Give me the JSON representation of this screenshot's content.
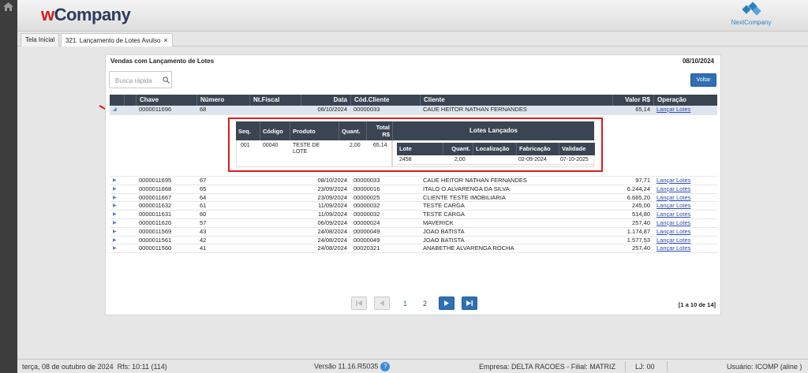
{
  "header": {
    "logo_w": "w",
    "logo_rest": "Company",
    "nc_logo": "NextCompany"
  },
  "tabs": [
    {
      "label": "Tela Inicial"
    },
    {
      "label": "321. Lançamento de Lotes Avulso",
      "close": "×"
    }
  ],
  "panel": {
    "title": "Vendas com Lançamento de Lotes",
    "date": "08/10/2024",
    "search_placeholder": "Busca rápida",
    "voltar": "Voltar"
  },
  "grid": {
    "headers": [
      "Chave",
      "Número",
      "Nt.Fiscal",
      "Data",
      "Cód.Cliente",
      "Cliente",
      "Valor R$",
      "Operação"
    ],
    "selected": {
      "chave": "0000011696",
      "numero": "68",
      "nf": "",
      "data": "08/10/2024",
      "cod": "00000033",
      "cliente": "CAUE HEITOR NATHAN FERNANDES",
      "valor": "65,14",
      "op": "Lançar Lotes"
    },
    "rows": [
      {
        "chave": "0000011695",
        "numero": "67",
        "nf": "",
        "data": "08/10/2024",
        "cod": "00000033",
        "cliente": "CAUE HEITOR NATHAN FERNANDES",
        "valor": "97,71",
        "op": "Lançar Lotes"
      },
      {
        "chave": "0000011668",
        "numero": "65",
        "nf": "",
        "data": "23/09/2024",
        "cod": "00000016",
        "cliente": "ITALO O.ALVARENGA DA SILVA",
        "valor": "6.244,24",
        "op": "Lançar Lotes"
      },
      {
        "chave": "0000011667",
        "numero": "64",
        "nf": "",
        "data": "23/09/2024",
        "cod": "00000025",
        "cliente": "CLIENTE TESTE IMOBILIARIA",
        "valor": "6.665,20",
        "op": "Lançar Lotes"
      },
      {
        "chave": "0000011632",
        "numero": "61",
        "nf": "",
        "data": "11/09/2024",
        "cod": "00000032",
        "cliente": "TESTE CARGA",
        "valor": "245,00",
        "op": "Lançar Lotes"
      },
      {
        "chave": "0000011631",
        "numero": "60",
        "nf": "",
        "data": "11/09/2024",
        "cod": "00000032",
        "cliente": "TESTE CARGA",
        "valor": "514,80",
        "op": "Lançar Lotes"
      },
      {
        "chave": "0000011620",
        "numero": "57",
        "nf": "",
        "data": "06/09/2024",
        "cod": "00000024",
        "cliente": "MAVERICK",
        "valor": "257,40",
        "op": "Lançar Lotes"
      },
      {
        "chave": "0000011569",
        "numero": "43",
        "nf": "",
        "data": "24/08/2024",
        "cod": "00000049",
        "cliente": "JOAO BATISTA",
        "valor": "1.174,87",
        "op": "Lançar Lotes"
      },
      {
        "chave": "0000011561",
        "numero": "42",
        "nf": "",
        "data": "24/08/2024",
        "cod": "00000049",
        "cliente": "JOAO BATISTA",
        "valor": "1.577,53",
        "op": "Lançar Lotes"
      },
      {
        "chave": "0000011560",
        "numero": "41",
        "nf": "",
        "data": "24/08/2024",
        "cod": "00020321",
        "cliente": "ANABETHE ALVARENGA ROCHA",
        "valor": "257,40",
        "op": "Lançar Lotes"
      }
    ]
  },
  "detail": {
    "headers": [
      "Seq.",
      "Código",
      "Produto",
      "Quant.",
      "Total R$"
    ],
    "row": {
      "seq": "001",
      "codigo": "00040",
      "produto": "TESTE DE LOTE",
      "quant": "2,00",
      "total": "65,14"
    },
    "lotes_title": "Lotes Lançados",
    "lotes_headers": [
      "Lote",
      "Quant.",
      "Localização",
      "Fabricação",
      "Validade"
    ],
    "lote_row": {
      "lote": "2458",
      "quant": "2,00",
      "loc": "",
      "fab": "02-09-2024",
      "val": "07-10-2025"
    }
  },
  "pager": {
    "pages": [
      "1",
      "2"
    ],
    "count": "[1 a 10 de 14]"
  },
  "status": {
    "date": "terça, 08 de outubro de 2024",
    "rfs": "Rfs: 10:11 (114)",
    "version": "Versão 11.16.R5035",
    "help": "?",
    "empresa": "Empresa: DELTA RACOES - Filial: MATRIZ",
    "lj": "LJ: 00",
    "usuario": "Usuário: ICOMP (aline )"
  },
  "colors": {
    "accent": "#2f6fb3",
    "header_dark": "#3a4452",
    "highlight": "#e01a1a"
  }
}
